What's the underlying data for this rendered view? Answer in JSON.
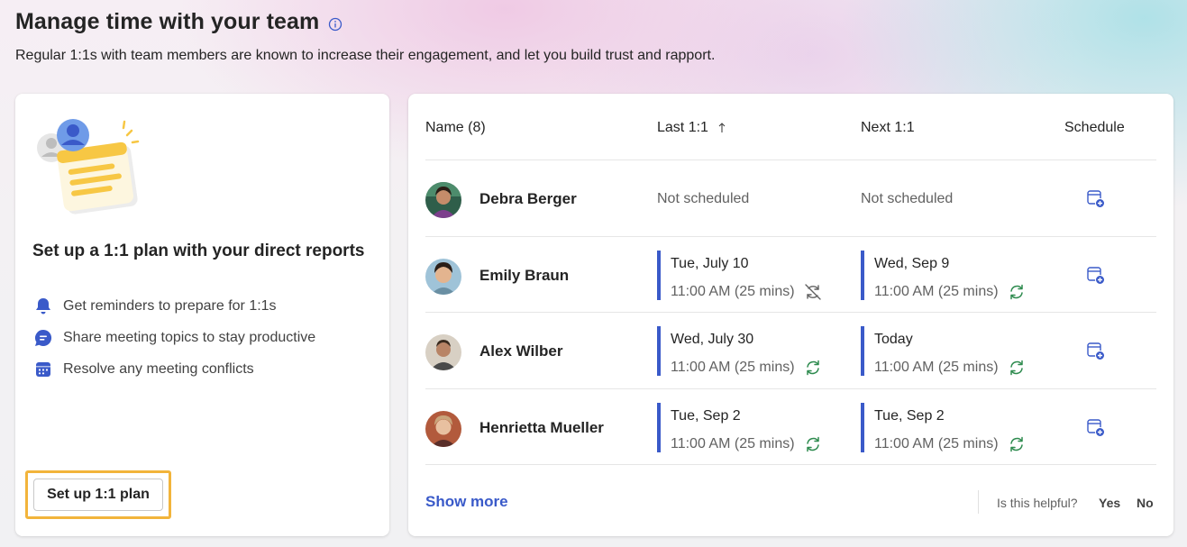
{
  "header": {
    "title": "Manage time with your team",
    "subtitle": "Regular 1:1s with team members are known to increase their engagement, and let you build trust and rapport."
  },
  "plan_card": {
    "heading": "Set up a 1:1 plan with your direct reports",
    "features": [
      {
        "icon": "bell-icon",
        "label": "Get reminders to prepare for 1:1s"
      },
      {
        "icon": "chat-icon",
        "label": "Share meeting topics to stay productive"
      },
      {
        "icon": "calendar-icon",
        "label": "Resolve any meeting conflicts"
      }
    ],
    "button_label": "Set up 1:1 plan"
  },
  "table": {
    "columns": {
      "name": "Name (8)",
      "last": "Last 1:1",
      "next": "Next 1:1",
      "schedule": "Schedule"
    },
    "rows": [
      {
        "name": "Debra Berger",
        "last_status": "Not scheduled",
        "next_status": "Not scheduled"
      },
      {
        "name": "Emily Braun",
        "last_date": "Tue, July 10",
        "last_time": "11:00 AM (25 mins)",
        "last_icon": "recurrence-off-icon",
        "next_date": "Wed, Sep 9",
        "next_time": "11:00 AM (25 mins)",
        "next_icon": "recurrence-icon"
      },
      {
        "name": "Alex Wilber",
        "last_date": "Wed, July 30",
        "last_time": "11:00 AM (25 mins)",
        "last_icon": "recurrence-icon",
        "next_date": "Today",
        "next_time": "11:00 AM (25 mins)",
        "next_icon": "recurrence-icon"
      },
      {
        "name": "Henrietta Mueller",
        "last_date": "Tue, Sep 2",
        "last_time": "11:00 AM (25 mins)",
        "last_icon": "recurrence-icon",
        "next_date": "Tue, Sep 2",
        "next_time": "11:00 AM (25 mins)",
        "next_icon": "recurrence-icon"
      }
    ]
  },
  "footer": {
    "show_more": "Show more",
    "helpful_prompt": "Is this helpful?",
    "yes": "Yes",
    "no": "No"
  },
  "colors": {
    "accent": "#3a5ac9",
    "recurrence_green": "#2e8b4f",
    "highlight_border": "#f2b43b"
  }
}
